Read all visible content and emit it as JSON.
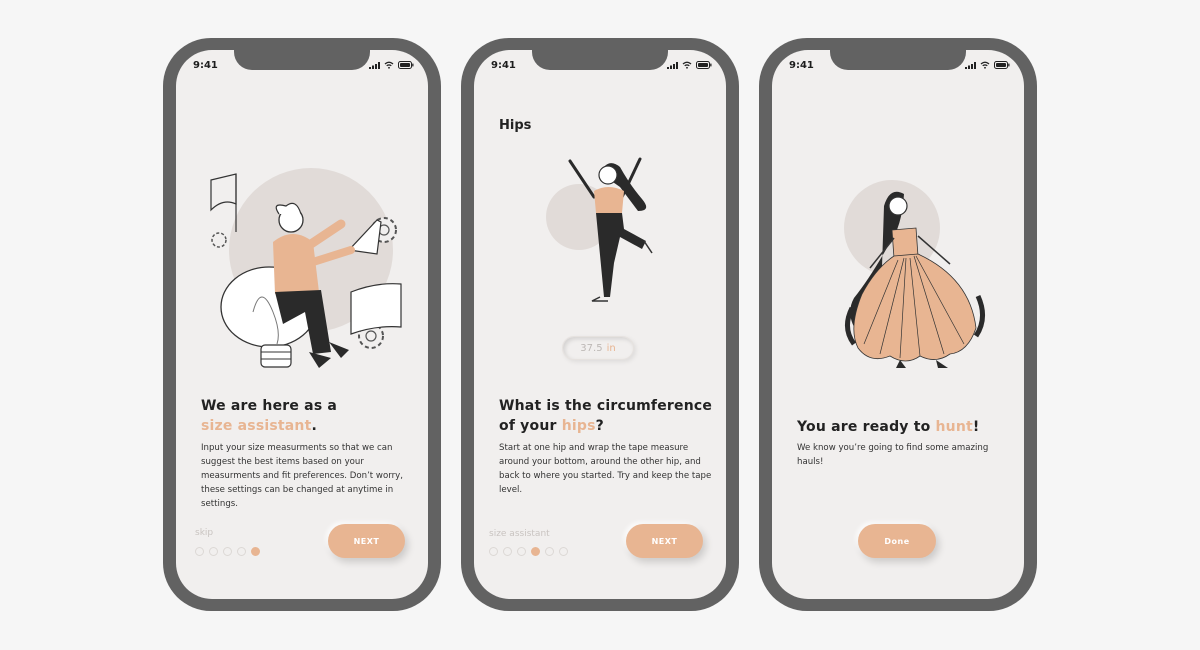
{
  "status_time": "9:41",
  "colors": {
    "accent": "#e8b592",
    "frame": "#626262",
    "screen": "#f1efee"
  },
  "screen1": {
    "heading_line1": "We are here as a",
    "heading_accent": "size assistant",
    "heading_end": ".",
    "body": "Input your size measurments so that we can suggest the best items based on your measurments and fit preferences. Don’t worry, these settings can be changed at anytime in settings.",
    "skip_label": "skip",
    "next_label": "NEXT",
    "dots_total": 5,
    "active_dot": 5
  },
  "screen2": {
    "title": "Hips",
    "measure_value": "37.5",
    "measure_unit": "in",
    "heading_line1": "What is the circumference",
    "heading_pre": "of your ",
    "heading_accent": "hips",
    "heading_end": "?",
    "body": "Start at one hip and wrap the tape measure around your bottom, around the other hip, and back to where you started. Try and keep the tape level.",
    "secondary_label": "size assistant",
    "next_label": "NEXT",
    "dots_total": 6,
    "active_dot": 4
  },
  "screen3": {
    "heading_pre": "You are ready to ",
    "heading_accent": "hunt",
    "heading_end": "!",
    "body": "We know you’re going to find some amazing hauls!",
    "done_label": "Done"
  }
}
